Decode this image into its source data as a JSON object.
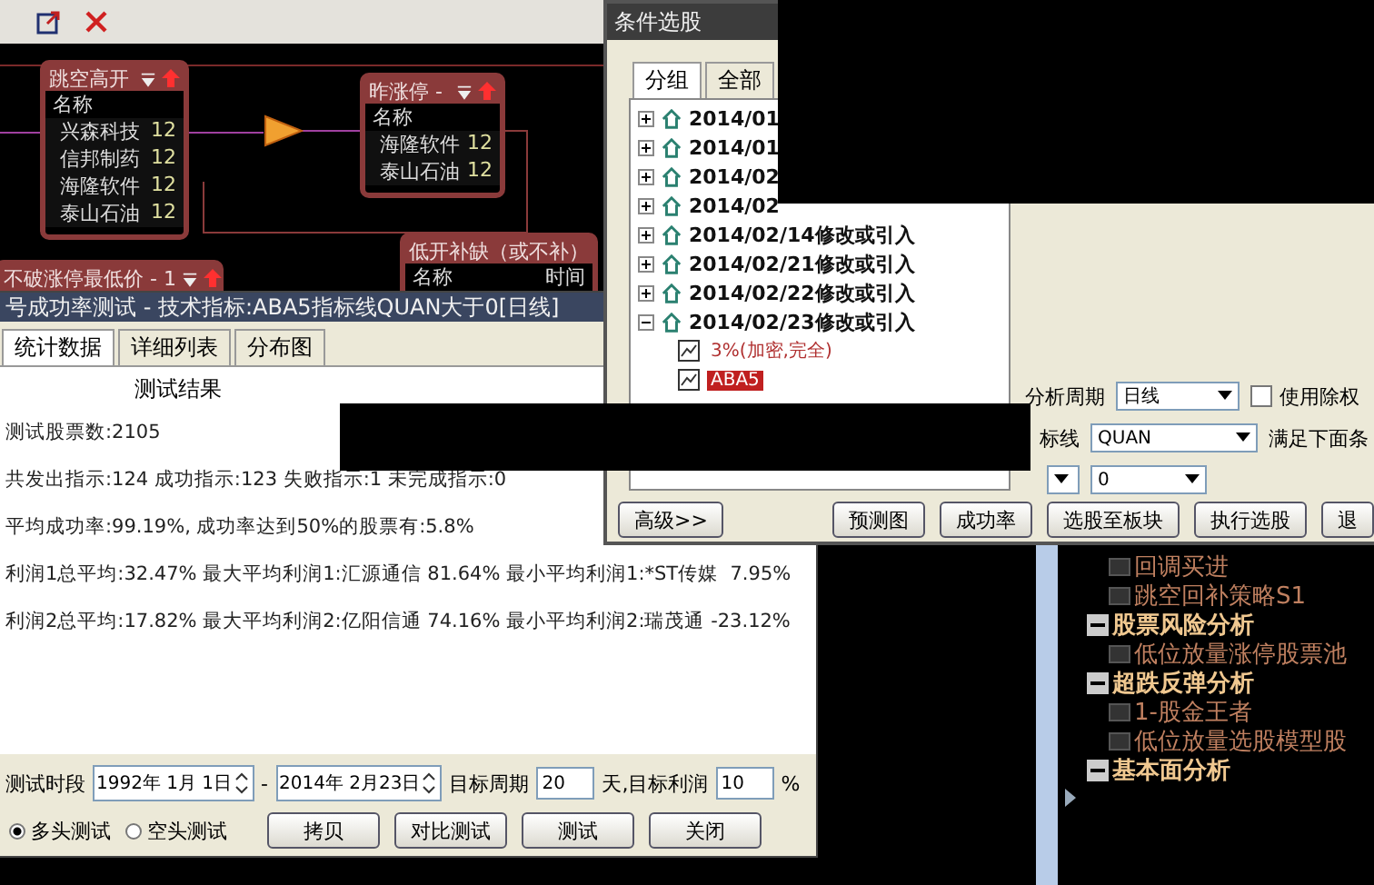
{
  "diagram": {
    "nodes": [
      {
        "title": "跳空高开",
        "columns": [
          "名称"
        ],
        "rows": [
          {
            "name": "兴森科技",
            "value": "12"
          },
          {
            "name": "信邦制药",
            "value": "12"
          },
          {
            "name": "海隆软件",
            "value": "12"
          },
          {
            "name": "泰山石油",
            "value": "12"
          }
        ],
        "menu": true
      },
      {
        "title": "昨涨停 -",
        "columns": [
          "名称"
        ],
        "rows": [
          {
            "name": "海隆软件",
            "value": "12"
          },
          {
            "name": "泰山石油",
            "value": "12"
          }
        ],
        "menu": true
      },
      {
        "title": "不破涨停最低价 - 1",
        "menu": true
      },
      {
        "title": "低开补缺（或不补）",
        "columns": [
          "名称",
          "时间"
        ],
        "menu": false
      }
    ]
  },
  "test_window": {
    "title": "号成功率测试 - 技术指标:ABA5指标线QUAN大于0[日线]",
    "tabs": [
      {
        "label": "统计数据",
        "selected": true
      },
      {
        "label": "详细列表",
        "selected": false
      },
      {
        "label": "分布图",
        "selected": false
      }
    ],
    "heading": "测试结果",
    "lines": [
      "测试股票数:2105",
      "共发出指示:124 成功指示:123 失败指示:1 未完成指示:0",
      "平均成功率:99.19%, 成功率达到50%的股票有:5.8%",
      "利润1总平均:32.47% 最大平均利润1:汇源通信 81.64% 最小平均利润1:*ST传媒  7.95%",
      "利润2总平均:17.82% 最大平均利润2:亿阳信通 74.16% 最小平均利润2:瑞茂通 -23.12%"
    ],
    "period_label": "测试时段",
    "start_date": "1992年 1月 1日",
    "dash": "-",
    "end_date": "2014年 2月23日",
    "target_period_label": "目标周期",
    "target_period": "20",
    "target_profit_label": "天,目标利润",
    "target_profit": "10",
    "percent": "%",
    "modes": [
      {
        "label": "多头测试",
        "selected": true
      },
      {
        "label": "空头测试",
        "selected": false
      }
    ],
    "buttons": [
      "拷贝",
      "对比测试",
      "测试",
      "关闭"
    ]
  },
  "condition_window": {
    "title": "条件选股",
    "tabs": [
      {
        "label": "分组",
        "selected": true
      },
      {
        "label": "全部",
        "selected": false
      }
    ],
    "tree": [
      {
        "label": "2014/01",
        "expanded": false
      },
      {
        "label": "2014/01",
        "expanded": false
      },
      {
        "label": "2014/02",
        "expanded": false
      },
      {
        "label": "2014/02",
        "expanded": false
      },
      {
        "label": "2014/02/14修改或引入",
        "expanded": false
      },
      {
        "label": "2014/02/21修改或引入",
        "expanded": false
      },
      {
        "label": "2014/02/22修改或引入",
        "expanded": false
      },
      {
        "label": "2014/02/23修改或引入",
        "expanded": true,
        "children": [
          {
            "label": "3%(加密,完全)",
            "selected": false
          },
          {
            "label": "ABA5",
            "selected": true
          }
        ]
      }
    ],
    "period_label": "分析周期",
    "period": "日线",
    "adjust": {
      "label": "使用除权",
      "checked": false
    },
    "line_label": "标线",
    "line": "QUAN",
    "condition_label": "满足下面条",
    "value": "0",
    "buttons": [
      "高级>>",
      "预测图",
      "成功率",
      "选股至板块",
      "执行选股",
      "退"
    ]
  },
  "strategy_tree": [
    {
      "kind": "leaf",
      "label": "回调买进"
    },
    {
      "kind": "leaf",
      "label": "跳空回补策略S1"
    },
    {
      "kind": "group",
      "label": "股票风险分析",
      "expanded": true,
      "children": [
        {
          "label": "低位放量涨停股票池"
        }
      ]
    },
    {
      "kind": "group",
      "label": "超跌反弹分析",
      "expanded": true,
      "children": [
        {
          "label": "1-股金王者"
        },
        {
          "label": "低位放量选股模型股"
        }
      ]
    },
    {
      "kind": "group",
      "label": "基本面分析",
      "expanded": true
    }
  ]
}
